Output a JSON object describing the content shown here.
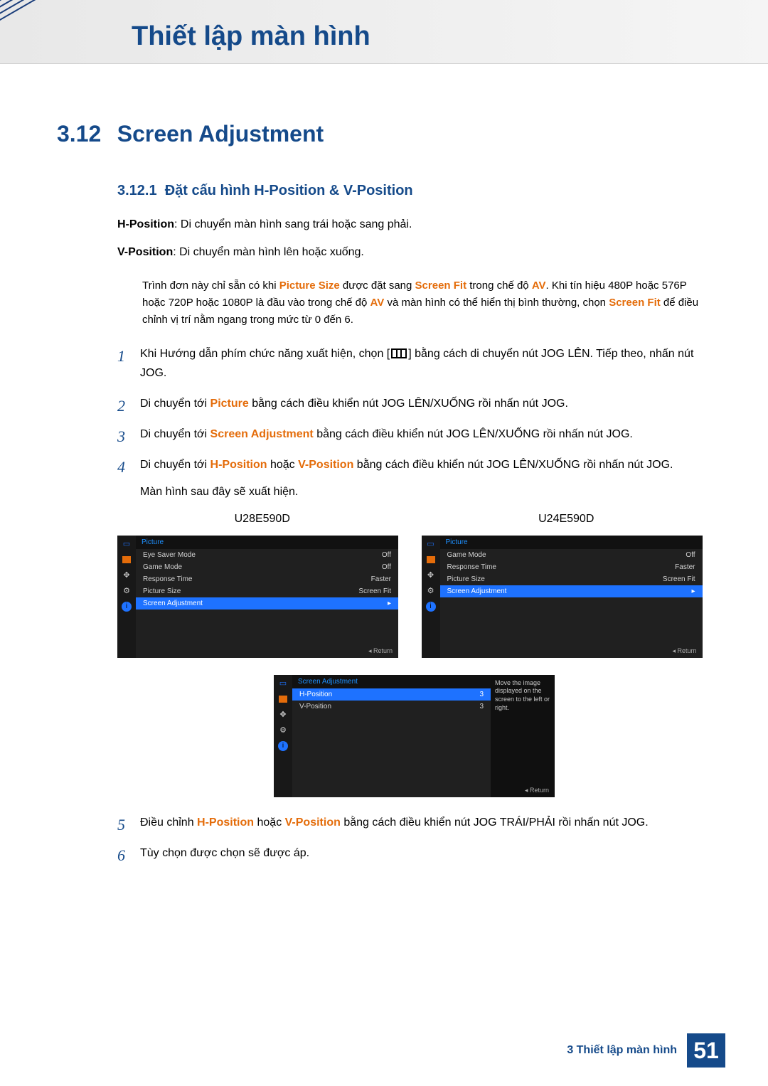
{
  "chapter": {
    "title": "Thiết lập màn hình"
  },
  "section": {
    "num": "3.12",
    "title": "Screen Adjustment"
  },
  "subsection": {
    "num": "3.12.1",
    "title": "Đặt cấu hình H-Position & V-Position"
  },
  "hpos": {
    "label": "H-Position",
    "desc": ": Di chuyển màn hình sang trái hoặc sang phải."
  },
  "vpos": {
    "label": "V-Position",
    "desc": ": Di chuyển màn hình lên hoặc xuống."
  },
  "note": {
    "p1a": "Trình đơn này chỉ sẵn có khi ",
    "p1b": "Picture Size",
    "p1c": " được đặt sang ",
    "p1d": "Screen Fit",
    "p1e": " trong chế độ ",
    "p1f": "AV",
    "p1g": ". Khi tín hiệu 480P hoặc 576P hoặc 720P hoặc 1080P là đầu vào trong chế độ ",
    "p1h": "AV",
    "p1i": " và màn hình có thể hiển thị bình thường, chọn ",
    "p1j": "Screen Fit",
    "p1k": " để điều chỉnh vị trí nằm ngang trong mức từ 0 đến 6."
  },
  "steps": {
    "s1a": "Khi Hướng dẫn phím chức năng xuất hiện, chọn [",
    "s1b": "] bằng cách di chuyển nút JOG LÊN. Tiếp theo, nhấn nút JOG.",
    "s2a": "Di chuyển tới ",
    "s2b": "Picture",
    "s2c": " bằng cách điều khiển nút JOG LÊN/XUỐNG rồi nhấn nút JOG.",
    "s3a": "Di chuyển tới ",
    "s3b": "Screen Adjustment",
    "s3c": " bằng cách điều khiển nút JOG LÊN/XUỐNG rồi nhấn nút JOG.",
    "s4a": "Di chuyển tới ",
    "s4b": "H-Position",
    "s4c": " hoặc ",
    "s4d": "V-Position",
    "s4e": " bằng cách điều khiển nút JOG LÊN/XUỐNG rồi nhấn nút JOG.",
    "s4f": "Màn hình sau đây sẽ xuất hiện.",
    "s5a": "Điều chỉnh ",
    "s5b": "H-Position",
    "s5c": " hoặc ",
    "s5d": "V-Position",
    "s5e": " bằng cách điều khiển nút JOG TRÁI/PHẢI rồi nhấn nút JOG.",
    "s6": "Tùy chọn được chọn sẽ được áp."
  },
  "nums": {
    "1": "1",
    "2": "2",
    "3": "3",
    "4": "4",
    "5": "5",
    "6": "6"
  },
  "osd_models": {
    "left": "U28E590D",
    "right": "U24E590D"
  },
  "osd_left": {
    "title": "Picture",
    "rows": [
      {
        "label": "Eye Saver Mode",
        "value": "Off"
      },
      {
        "label": "Game Mode",
        "value": "Off"
      },
      {
        "label": "Response Time",
        "value": "Faster"
      },
      {
        "label": "Picture Size",
        "value": "Screen Fit"
      }
    ],
    "selected": {
      "label": "Screen Adjustment",
      "arrow": "▸"
    },
    "return": "Return"
  },
  "osd_right": {
    "title": "Picture",
    "rows": [
      {
        "label": "Game Mode",
        "value": "Off"
      },
      {
        "label": "Response Time",
        "value": "Faster"
      },
      {
        "label": "Picture Size",
        "value": "Screen Fit"
      }
    ],
    "selected": {
      "label": "Screen Adjustment",
      "arrow": "▸"
    },
    "return": "Return"
  },
  "osd_bottom": {
    "title": "Screen Adjustment",
    "selected": {
      "label": "H-Position",
      "value": "3"
    },
    "row2": {
      "label": "V-Position",
      "value": "3"
    },
    "hint": "Move the image displayed on the screen to the left or right.",
    "return": "Return"
  },
  "footer": {
    "text": "3 Thiết lập màn hình",
    "page": "51"
  }
}
